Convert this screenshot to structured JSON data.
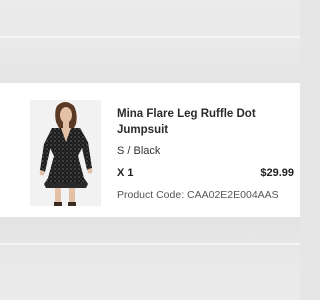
{
  "product": {
    "name": "Mina Flare Leg Ruffle Dot Jumpsuit",
    "variant": "S / Black",
    "quantity": "X 1",
    "price": "$29.99",
    "product_code": "Product Code: CAA02E2E004AAS"
  },
  "colors": {
    "background": "#e6e6e6",
    "card": "#ffffff",
    "text": "#2b2b2b",
    "muted_text": "#555555"
  }
}
